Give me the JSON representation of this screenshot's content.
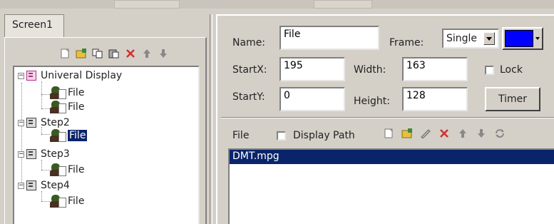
{
  "tabs": [
    {
      "label": "Screen1"
    }
  ],
  "tree": {
    "groups": [
      {
        "label": "Univeral Display",
        "children": [
          "File",
          "File"
        ]
      },
      {
        "label": "Step2",
        "children": [
          "File"
        ]
      },
      {
        "label": "Step3",
        "children": [
          "File"
        ]
      },
      {
        "label": "Step4",
        "children": [
          "File"
        ]
      }
    ]
  },
  "properties": {
    "name_label": "Name:",
    "name_value": "File",
    "frame_label": "Frame:",
    "frame_value": "Single",
    "frame_color": "#0000ff",
    "startx_label": "StartX:",
    "startx_value": "195",
    "width_label": "Width:",
    "width_value": "163",
    "lock_label": "Lock",
    "starty_label": "StartY:",
    "starty_value": "0",
    "height_label": "Height:",
    "height_value": "128",
    "timer_button": "Timer"
  },
  "files": {
    "label": "File",
    "display_path_label": "Display Path",
    "items": [
      "DMT.mpg"
    ]
  },
  "icons": {
    "left_toolbar": [
      "new-icon",
      "add-folder-icon",
      "copy-icon",
      "paste-icon",
      "delete-icon",
      "move-up-icon",
      "move-down-icon"
    ],
    "right_toolbar": [
      "new-icon",
      "add-folder-icon",
      "edit-icon",
      "delete-icon",
      "move-up-icon",
      "move-down-icon",
      "refresh-icon"
    ]
  },
  "colors": {
    "selection": "#0a246a",
    "accent_red": "#d03030"
  }
}
